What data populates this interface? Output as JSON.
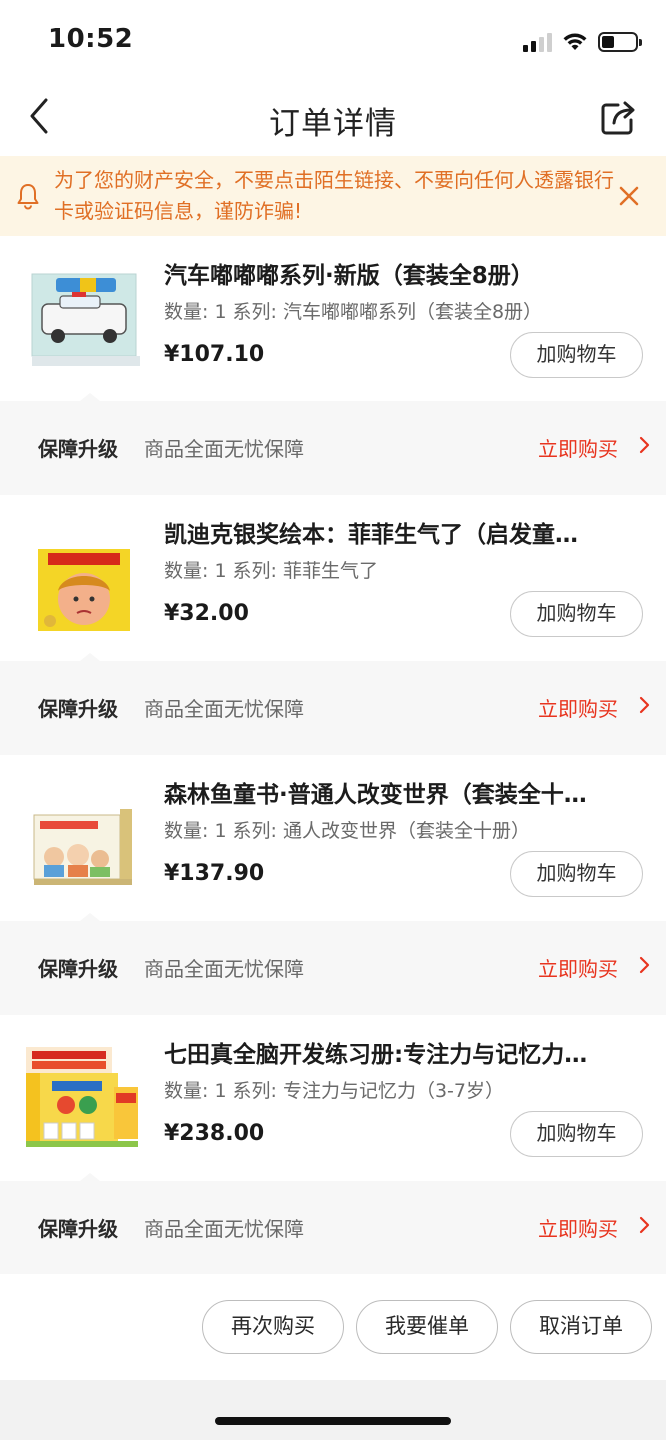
{
  "status_bar": {
    "time": "10:52"
  },
  "header": {
    "title": "订单详情"
  },
  "notice": {
    "text": "为了您的财产安全，不要点击陌生链接、不要向任何人透露银行卡或验证码信息，谨防诈骗!"
  },
  "products": [
    {
      "title": "汽车嘟嘟嘟系列·新版（套装全8册）",
      "qty_label": "数量: 1",
      "series_label": "系列: 汽车嘟嘟嘟系列（套装全8册）",
      "price": "¥107.10",
      "cart_label": "加购物车"
    },
    {
      "title": "凯迪克银奖绘本：菲菲生气了（启发童…",
      "qty_label": "数量: 1",
      "series_label": "系列: 菲菲生气了",
      "price": "¥32.00",
      "cart_label": "加购物车"
    },
    {
      "title": "森林鱼童书·普通人改变世界（套装全十…",
      "qty_label": "数量: 1",
      "series_label": "系列: 通人改变世界（套装全十册）",
      "price": "¥137.90",
      "cart_label": "加购物车"
    },
    {
      "title": "七田真全脑开发练习册:专注力与记忆力…",
      "qty_label": "数量: 1",
      "series_label": "系列: 专注力与记忆力（3-7岁）",
      "price": "¥238.00",
      "cart_label": "加购物车"
    }
  ],
  "guarantee": {
    "label": "保障升级",
    "desc": "商品全面无忧保障",
    "action": "立即购买"
  },
  "footer_actions": {
    "rebuy": "再次购买",
    "urge": "我要催单",
    "cancel": "取消订单"
  },
  "colors": {
    "accent_red": "#e8341f",
    "notice_bg": "#fdf5e4",
    "notice_text": "#e06f25"
  }
}
